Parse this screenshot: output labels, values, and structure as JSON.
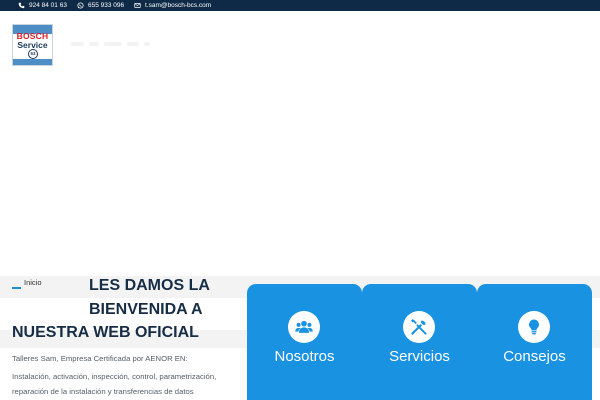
{
  "topbar": {
    "phone1": "924 84 01 63",
    "phone2": "655 933 096",
    "email": "t.sam@bosch-bcs.com",
    "background": "#0e2a47"
  },
  "logo": {
    "brand": "BOSCH",
    "sub": "Service",
    "emblem": "63"
  },
  "breadcrumb": {
    "label": "Inicio"
  },
  "hero": {
    "line1": "LES DAMOS LA",
    "line2": "BIENVENIDA A",
    "line3": "NUESTRA WEB OFICIAL"
  },
  "intro": {
    "line1": "Talleres Sam, Empresa Certificada por AENOR EN:",
    "line2": "Instalación, activación, inspección, control, parametrización,",
    "line3": "reparación de la instalación y transferencias de datos"
  },
  "cards": [
    {
      "label": "Nosotros",
      "icon": "users-icon"
    },
    {
      "label": "Servicios",
      "icon": "tools-icon"
    },
    {
      "label": "Consejos",
      "icon": "lightbulb-icon"
    }
  ],
  "colors": {
    "accent": "#1992e2",
    "heading": "#172d45"
  }
}
